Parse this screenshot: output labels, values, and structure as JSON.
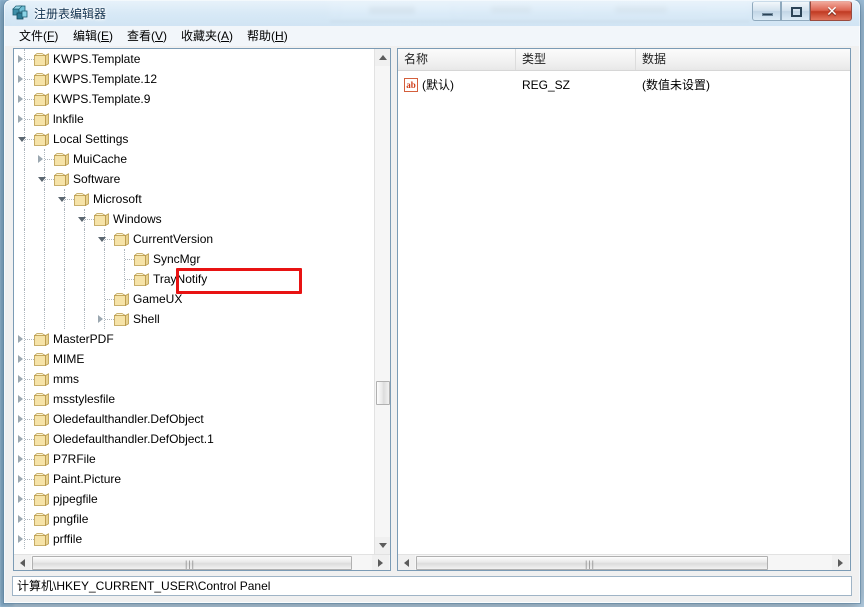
{
  "window": {
    "title": "注册表编辑器",
    "icon": "regedit-icon",
    "controls": {
      "minimize": "最小化",
      "maximize": "最大化",
      "close": "✕"
    }
  },
  "menubar": [
    {
      "label": "文件",
      "mnemonic": "F"
    },
    {
      "label": "编辑",
      "mnemonic": "E"
    },
    {
      "label": "查看",
      "mnemonic": "V"
    },
    {
      "label": "收藏夹",
      "mnemonic": "A"
    },
    {
      "label": "帮助",
      "mnemonic": "H"
    }
  ],
  "tree": {
    "nodes": [
      {
        "label": "KWPS.Template",
        "depth": 1,
        "state": "collapsed"
      },
      {
        "label": "KWPS.Template.12",
        "depth": 1,
        "state": "collapsed"
      },
      {
        "label": "KWPS.Template.9",
        "depth": 1,
        "state": "collapsed"
      },
      {
        "label": "lnkfile",
        "depth": 1,
        "state": "collapsed"
      },
      {
        "label": "Local Settings",
        "depth": 1,
        "state": "expanded"
      },
      {
        "label": "MuiCache",
        "depth": 2,
        "state": "collapsed"
      },
      {
        "label": "Software",
        "depth": 2,
        "state": "expanded"
      },
      {
        "label": "Microsoft",
        "depth": 3,
        "state": "expanded"
      },
      {
        "label": "Windows",
        "depth": 4,
        "state": "expanded"
      },
      {
        "label": "CurrentVersion",
        "depth": 5,
        "state": "expanded"
      },
      {
        "label": "SyncMgr",
        "depth": 6,
        "state": "leaf"
      },
      {
        "label": "TrayNotify",
        "depth": 6,
        "state": "leaf"
      },
      {
        "label": "GameUX",
        "depth": 5,
        "state": "leaf"
      },
      {
        "label": "Shell",
        "depth": 5,
        "state": "collapsed"
      },
      {
        "label": "MasterPDF",
        "depth": 1,
        "state": "collapsed"
      },
      {
        "label": "MIME",
        "depth": 1,
        "state": "collapsed"
      },
      {
        "label": "mms",
        "depth": 1,
        "state": "collapsed"
      },
      {
        "label": "msstylesfile",
        "depth": 1,
        "state": "collapsed"
      },
      {
        "label": "Oledefaulthandler.DefObject",
        "depth": 1,
        "state": "collapsed"
      },
      {
        "label": "Oledefaulthandler.DefObject.1",
        "depth": 1,
        "state": "collapsed"
      },
      {
        "label": "P7RFile",
        "depth": 1,
        "state": "collapsed"
      },
      {
        "label": "Paint.Picture",
        "depth": 1,
        "state": "collapsed"
      },
      {
        "label": "pjpegfile",
        "depth": 1,
        "state": "collapsed"
      },
      {
        "label": "pngfile",
        "depth": 1,
        "state": "collapsed"
      },
      {
        "label": "prffile",
        "depth": 1,
        "state": "collapsed"
      }
    ],
    "highlight": {
      "label": "TrayNotify",
      "color": "#e81313"
    }
  },
  "list": {
    "columns": [
      "名称",
      "类型",
      "数据"
    ],
    "rows": [
      {
        "name": "(默认)",
        "type": "REG_SZ",
        "data": "(数值未设置)",
        "icon": "string-value-icon"
      }
    ]
  },
  "statusbar": {
    "path": "计算机\\HKEY_CURRENT_USER\\Control Panel"
  }
}
